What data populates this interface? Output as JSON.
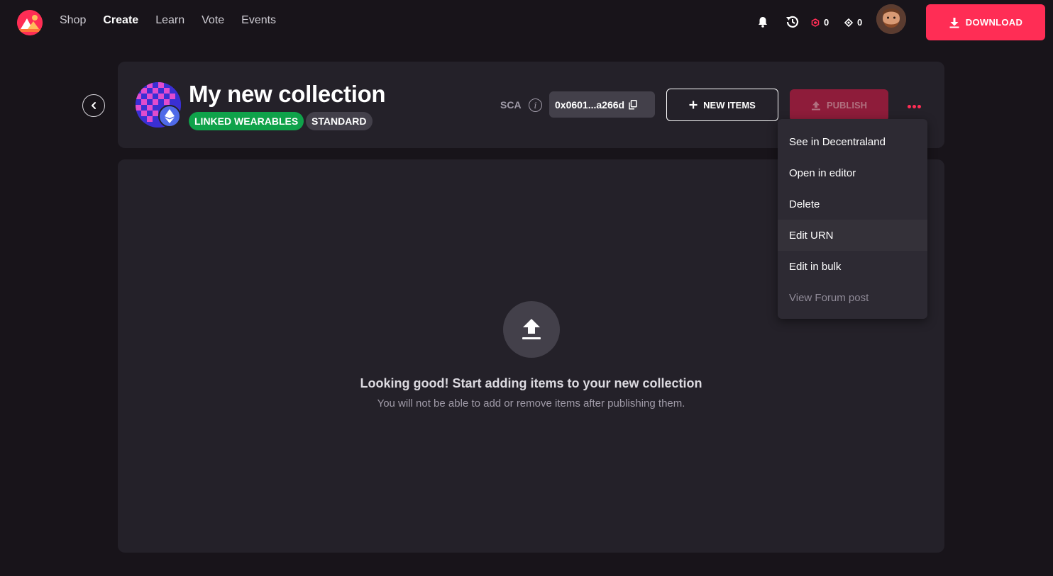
{
  "nav": {
    "items": [
      {
        "label": "Shop",
        "active": false
      },
      {
        "label": "Create",
        "active": true
      },
      {
        "label": "Learn",
        "active": false
      },
      {
        "label": "Vote",
        "active": false
      },
      {
        "label": "Events",
        "active": false
      }
    ]
  },
  "toolbar": {
    "mana_red_count": "0",
    "mana_eth_count": "0",
    "download_label": "DOWNLOAD",
    "accent_color": "#ff2d55"
  },
  "collection": {
    "title": "My new collection",
    "tag_linked": "LINKED WEARABLES",
    "tag_standard": "STANDARD",
    "sca_label": "SCA",
    "address": "0x0601...a266d",
    "new_items_label": "NEW ITEMS",
    "publish_label": "PUBLISH"
  },
  "menu": {
    "items": [
      {
        "label": "See in Decentraland",
        "state": "normal"
      },
      {
        "label": "Open in editor",
        "state": "normal"
      },
      {
        "label": "Delete",
        "state": "normal"
      },
      {
        "label": "Edit URN",
        "state": "hover"
      },
      {
        "label": "Edit in bulk",
        "state": "normal"
      },
      {
        "label": "View Forum post",
        "state": "disabled"
      }
    ]
  },
  "empty_state": {
    "title": "Looking good! Start adding items to your new collection",
    "subtitle": "You will not be able to add or remove items after publishing them."
  }
}
